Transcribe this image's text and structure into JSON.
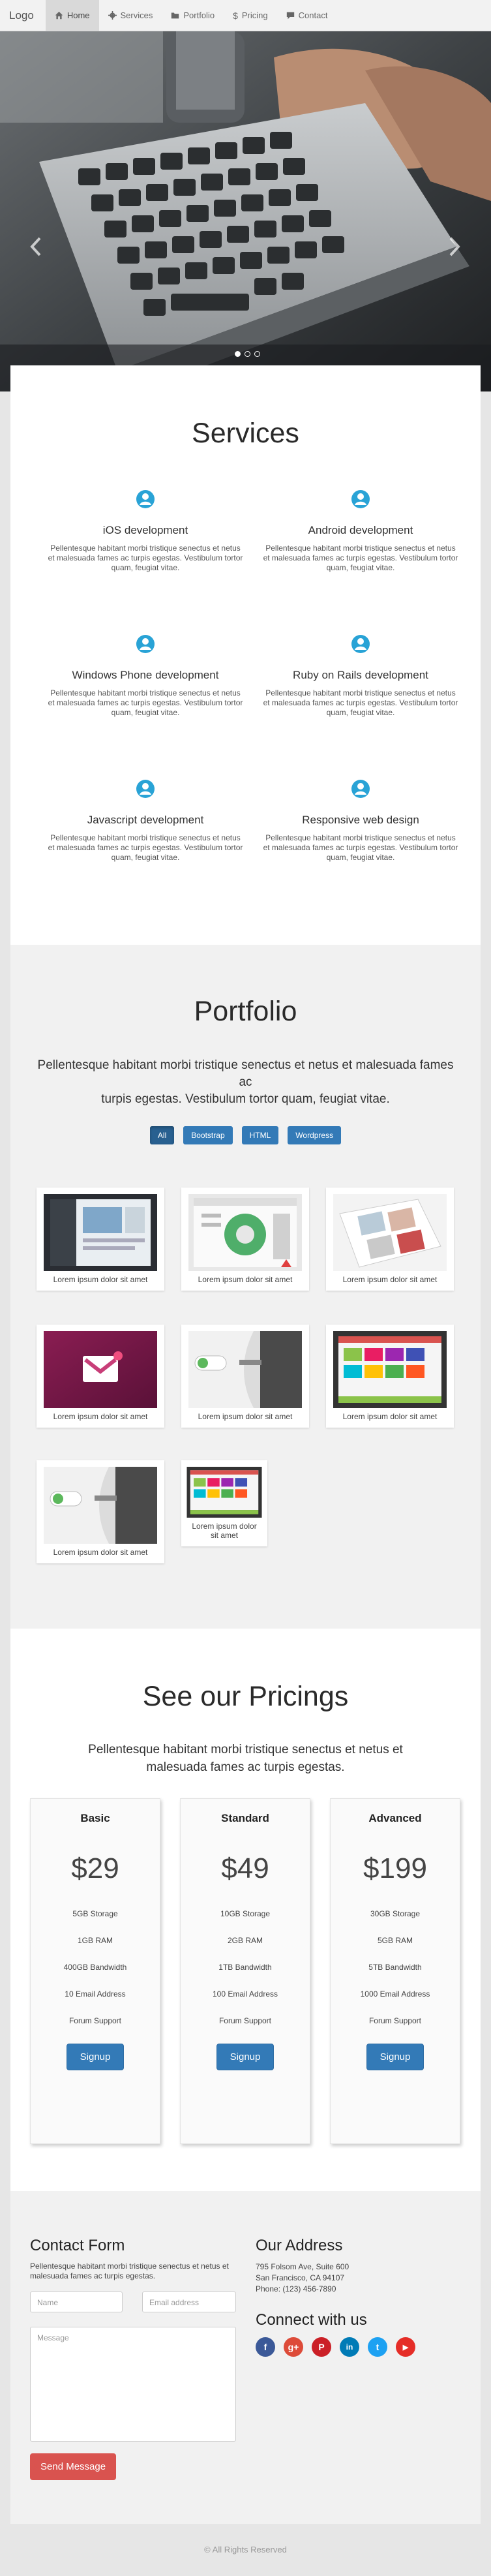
{
  "navbar": {
    "brand": "Logo",
    "items": [
      {
        "label": "Home",
        "icon": "home-icon",
        "active": true
      },
      {
        "label": "Services",
        "icon": "gear-icon"
      },
      {
        "label": "Portfolio",
        "icon": "folder-icon"
      },
      {
        "label": "Pricing",
        "icon": "dollar-icon"
      },
      {
        "label": "Contact",
        "icon": "comment-icon"
      }
    ]
  },
  "hero": {
    "prev_icon": "chevron-left-icon",
    "next_icon": "chevron-right-icon",
    "slides_count": 3,
    "active_slide": 1
  },
  "services": {
    "title": "Services",
    "icon": "user-circle-icon",
    "items": [
      {
        "title": "iOS development",
        "text": "Pellentesque habitant morbi tristique senectus et netus et malesuada fames ac turpis egestas. Vestibulum tortor quam, feugiat vitae."
      },
      {
        "title": "Android development",
        "text": "Pellentesque habitant morbi tristique senectus et netus et malesuada fames ac turpis egestas. Vestibulum tortor quam, feugiat vitae."
      },
      {
        "title": "Windows Phone development",
        "text": "Pellentesque habitant morbi tristique senectus et netus et malesuada fames ac turpis egestas. Vestibulum tortor quam, feugiat vitae."
      },
      {
        "title": "Ruby on Rails development",
        "text": "Pellentesque habitant morbi tristique senectus et netus et malesuada fames ac turpis egestas. Vestibulum tortor quam, feugiat vitae."
      },
      {
        "title": "Javascript development",
        "text": "Pellentesque habitant morbi tristique senectus et netus et malesuada fames ac turpis egestas. Vestibulum tortor quam, feugiat vitae."
      },
      {
        "title": "Responsive web design",
        "text": "Pellentesque habitant morbi tristique senectus et netus et malesuada fames ac turpis egestas. Vestibulum tortor quam, feugiat vitae."
      }
    ]
  },
  "portfolio": {
    "title": "Portfolio",
    "lead_line1": "Pellentesque habitant morbi tristique senectus et netus et malesuada fames ac",
    "lead_line2": "turpis egestas. Vestibulum tortor quam, feugiat vitae.",
    "filters": [
      {
        "label": "All",
        "active": true
      },
      {
        "label": "Bootstrap"
      },
      {
        "label": "HTML"
      },
      {
        "label": "Wordpress"
      }
    ],
    "items": [
      {
        "caption": "Lorem ipsum dolor sit amet"
      },
      {
        "caption": "Lorem ipsum dolor sit amet"
      },
      {
        "caption": "Lorem ipsum dolor sit amet"
      },
      {
        "caption": "Lorem ipsum dolor sit amet"
      },
      {
        "caption": "Lorem ipsum dolor sit amet"
      },
      {
        "caption": "Lorem ipsum dolor sit amet"
      },
      {
        "caption": "Lorem ipsum dolor sit amet"
      },
      {
        "caption": "Lorem ipsum dolor sit amet"
      }
    ]
  },
  "pricing": {
    "title": "See our Pricings",
    "lead": "Pellentesque habitant morbi tristique senectus et netus et malesuada fames ac turpis egestas.",
    "plans": [
      {
        "name": "Basic",
        "price": "$29",
        "features": [
          "5GB Storage",
          "1GB RAM",
          "400GB Bandwidth",
          "10 Email Address",
          "Forum Support"
        ],
        "button": "Signup"
      },
      {
        "name": "Standard",
        "price": "$49",
        "features": [
          "10GB Storage",
          "2GB RAM",
          "1TB Bandwidth",
          "100 Email Address",
          "Forum Support"
        ],
        "button": "Signup"
      },
      {
        "name": "Advanced",
        "price": "$199",
        "features": [
          "30GB Storage",
          "5GB RAM",
          "5TB Bandwidth",
          "1000 Email Address",
          "Forum Support"
        ],
        "button": "Signup"
      }
    ]
  },
  "contact": {
    "form_title": "Contact Form",
    "form_text": "Pellentesque habitant morbi tristique senectus et netus et malesuada fames ac turpis egestas.",
    "name_placeholder": "Name",
    "email_placeholder": "Email address",
    "message_placeholder": "Message",
    "send_label": "Send Message",
    "address_title": "Our Address",
    "address_lines": [
      "795 Folsom Ave, Suite 600",
      "San Francisco, CA 94107",
      "Phone: (123) 456-7890"
    ],
    "connect_title": "Connect with us",
    "socials": [
      {
        "icon": "facebook-icon",
        "glyph": "f",
        "color": "#3b5998"
      },
      {
        "icon": "google-plus-icon",
        "glyph": "g+",
        "color": "#dd4b39"
      },
      {
        "icon": "pinterest-icon",
        "glyph": "P",
        "color": "#cb2027"
      },
      {
        "icon": "linkedin-icon",
        "glyph": "in",
        "color": "#007bb6"
      },
      {
        "icon": "twitter-icon",
        "glyph": "t",
        "color": "#1da1f2"
      },
      {
        "icon": "youtube-icon",
        "glyph": "▶",
        "color": "#e52d27"
      }
    ]
  },
  "footer": {
    "text": "© All Rights Reserved"
  }
}
